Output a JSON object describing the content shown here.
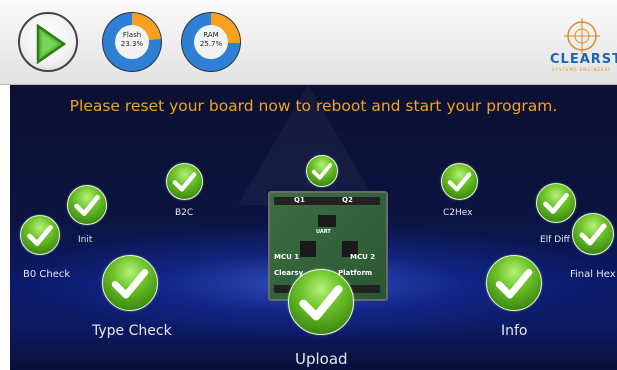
{
  "toolbar": {
    "flash": {
      "label": "Flash",
      "value": "23.3%",
      "fraction": 0.233
    },
    "ram": {
      "label": "RAM",
      "value": "25.7%",
      "fraction": 0.257
    },
    "logo": {
      "text": "CLEARST",
      "subtext": "SYSTEMS ENGINEERI"
    }
  },
  "stage": {
    "prompt": "Please reset your board now to reboot and start your program."
  },
  "board": {
    "labels": [
      "Q1",
      "Q2",
      "UART",
      "MCU 1",
      "MCU 2",
      "Clearsy",
      "Platform"
    ]
  },
  "steps": {
    "b0_check": "B0 Check",
    "init": "Init",
    "b2c": "B2C",
    "type_check": "Type Check",
    "upload": "Upload",
    "c2hex": "C2Hex",
    "elf_diff": "Elf Diff",
    "final_hex": "Final Hex",
    "info": "Info"
  },
  "colors": {
    "accent": "#f3a21f",
    "gauge_used": "#f5a021",
    "gauge_free": "#2e7fd6",
    "check_green": "#5cb21f",
    "background": "#0b143f"
  }
}
